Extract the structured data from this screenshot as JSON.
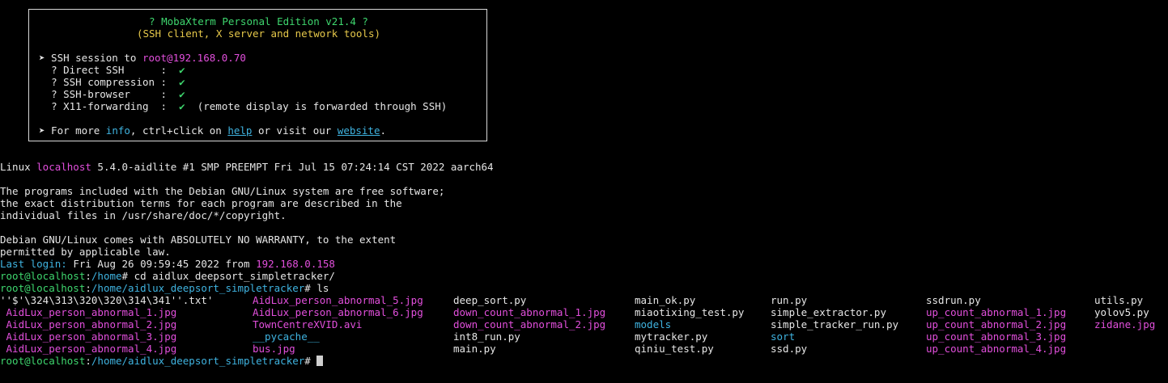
{
  "colors": {
    "background": "#000000",
    "text": "#e6e6e6",
    "green": "#3ed66e",
    "yellow": "#e6c84a",
    "magenta": "#e24fdc",
    "cyan": "#3fb3e0"
  },
  "banner": {
    "title": "? MobaXterm Personal Edition v21.4 ?",
    "subtitle": "(SSH client, X server and network tools)",
    "session_prefix": "➤ SSH session to ",
    "session_host": "root@192.168.0.70",
    "options": [
      {
        "label": "? Direct SSH      :",
        "value": "✔",
        "note": ""
      },
      {
        "label": "? SSH compression :",
        "value": "✔",
        "note": ""
      },
      {
        "label": "? SSH-browser     :",
        "value": "✔",
        "note": ""
      },
      {
        "label": "? X11-forwarding  :",
        "value": "✔",
        "note": "(remote display is forwarded through SSH)"
      }
    ],
    "info_prefix": "➤ For more ",
    "info_link": "info",
    "info_mid": ", ctrl+click on ",
    "help_link": "help",
    "info_mid2": " or visit our ",
    "website_link": "website",
    "info_end": "."
  },
  "motd": {
    "uname_prefix": "Linux ",
    "uname_host": "localhost",
    "uname_rest": " 5.4.0-aidlite #1 SMP PREEMPT Fri Jul 15 07:24:14 CST 2022 aarch64",
    "lines": [
      "The programs included with the Debian GNU/Linux system are free software;",
      "the exact distribution terms for each program are described in the",
      "individual files in /usr/share/doc/*/copyright.",
      "",
      "Debian GNU/Linux comes with ABSOLUTELY NO WARRANTY, to the extent",
      "permitted by applicable law."
    ],
    "last_login_label": "Last login:",
    "last_login_time": " Fri Aug 26 09:59:45 2022 from ",
    "last_login_ip": "192.168.0.158"
  },
  "session": {
    "prompt1_user": "root@localhost",
    "prompt1_sep": ":",
    "prompt1_path": "/home",
    "prompt1_cmd": "# cd aidlux_deepsort_simpletracker/",
    "prompt2_user": "root@localhost",
    "prompt2_sep": ":",
    "prompt2_path": "/home/aidlux_deepsort_simpletracker",
    "prompt2_cmd": "# ls",
    "prompt3_user": "root@localhost",
    "prompt3_sep": ":",
    "prompt3_path": "/home/aidlux_deepsort_simpletracker",
    "prompt3_cmd": "# "
  },
  "listing": {
    "columns": [
      [
        {
          "name": "''$'\\324\\313\\320\\320\\314\\341''.txt'",
          "color": "white"
        },
        {
          "name": " AidLux_person_abnormal_1.jpg",
          "color": "magenta"
        },
        {
          "name": " AidLux_person_abnormal_2.jpg",
          "color": "magenta"
        },
        {
          "name": " AidLux_person_abnormal_3.jpg",
          "color": "magenta"
        },
        {
          "name": " AidLux_person_abnormal_4.jpg",
          "color": "magenta"
        }
      ],
      [
        {
          "name": "AidLux_person_abnormal_5.jpg",
          "color": "magenta"
        },
        {
          "name": "AidLux_person_abnormal_6.jpg",
          "color": "magenta"
        },
        {
          "name": "TownCentreXVID.avi",
          "color": "magenta"
        },
        {
          "name": "__pycache__",
          "color": "cyan"
        },
        {
          "name": "bus.jpg",
          "color": "magenta"
        }
      ],
      [
        {
          "name": "deep_sort.py",
          "color": "white"
        },
        {
          "name": "down_count_abnormal_1.jpg",
          "color": "magenta"
        },
        {
          "name": "down_count_abnormal_2.jpg",
          "color": "magenta"
        },
        {
          "name": "int8_run.py",
          "color": "white"
        },
        {
          "name": "main.py",
          "color": "white"
        }
      ],
      [
        {
          "name": "main_ok.py",
          "color": "white"
        },
        {
          "name": "miaotixing_test.py",
          "color": "white"
        },
        {
          "name": "models",
          "color": "cyan"
        },
        {
          "name": "mytracker.py",
          "color": "white"
        },
        {
          "name": "qiniu_test.py",
          "color": "white"
        }
      ],
      [
        {
          "name": "run.py",
          "color": "white"
        },
        {
          "name": "simple_extractor.py",
          "color": "white"
        },
        {
          "name": "simple_tracker_run.py",
          "color": "white"
        },
        {
          "name": "sort",
          "color": "cyan"
        },
        {
          "name": "ssd.py",
          "color": "white"
        }
      ],
      [
        {
          "name": "ssdrun.py",
          "color": "white"
        },
        {
          "name": "up_count_abnormal_1.jpg",
          "color": "magenta"
        },
        {
          "name": "up_count_abnormal_2.jpg",
          "color": "magenta"
        },
        {
          "name": "up_count_abnormal_3.jpg",
          "color": "magenta"
        },
        {
          "name": "up_count_abnormal_4.jpg",
          "color": "magenta"
        }
      ],
      [
        {
          "name": "utils.py",
          "color": "white"
        },
        {
          "name": "yolov5.py",
          "color": "white"
        },
        {
          "name": "zidane.jpg",
          "color": "magenta"
        }
      ]
    ]
  }
}
